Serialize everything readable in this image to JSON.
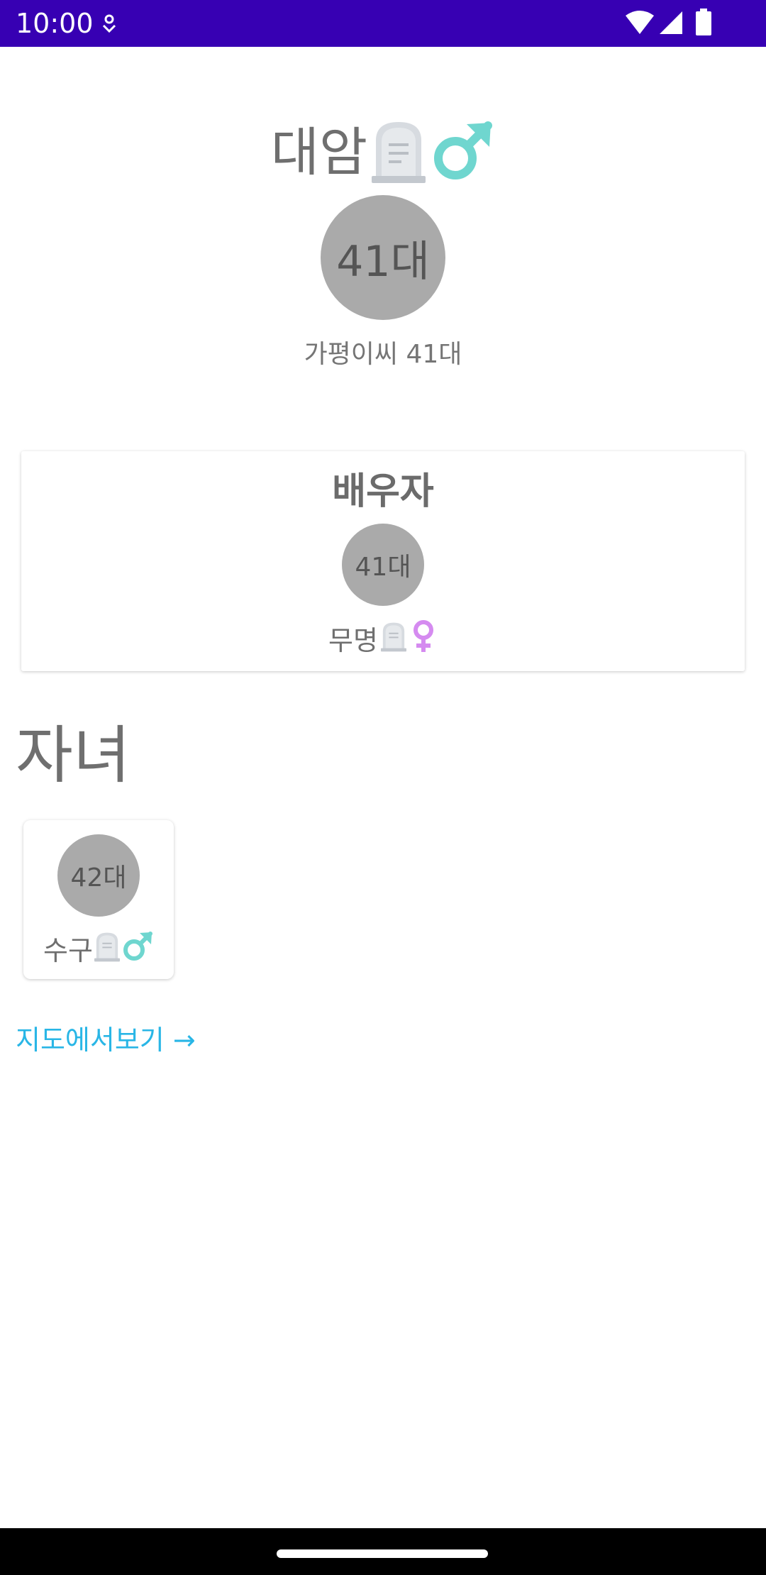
{
  "status_bar": {
    "time": "10:00",
    "icons": [
      "notification-icon",
      "wifi-icon",
      "signal-icon",
      "battery-icon"
    ]
  },
  "person": {
    "name": "대암",
    "generation": "41대",
    "subtitle": "가평이씨 41대",
    "deceased_icon": "headstone-icon",
    "gender_icon": "male-icon"
  },
  "spouse": {
    "title": "배우자",
    "generation": "41대",
    "name": "무명",
    "deceased_icon": "headstone-icon",
    "gender_icon": "female-icon"
  },
  "children": {
    "heading": "자녀",
    "items": [
      {
        "generation": "42대",
        "name": "수구",
        "deceased_icon": "headstone-icon",
        "gender_icon": "male-icon"
      }
    ]
  },
  "map_link": {
    "label": "지도에서보기 →"
  },
  "colors": {
    "status_bar": "#3700b3",
    "circle": "#aaaaaa",
    "link": "#29b6e6",
    "male": "#6fd6cf",
    "female": "#d58bf0"
  }
}
